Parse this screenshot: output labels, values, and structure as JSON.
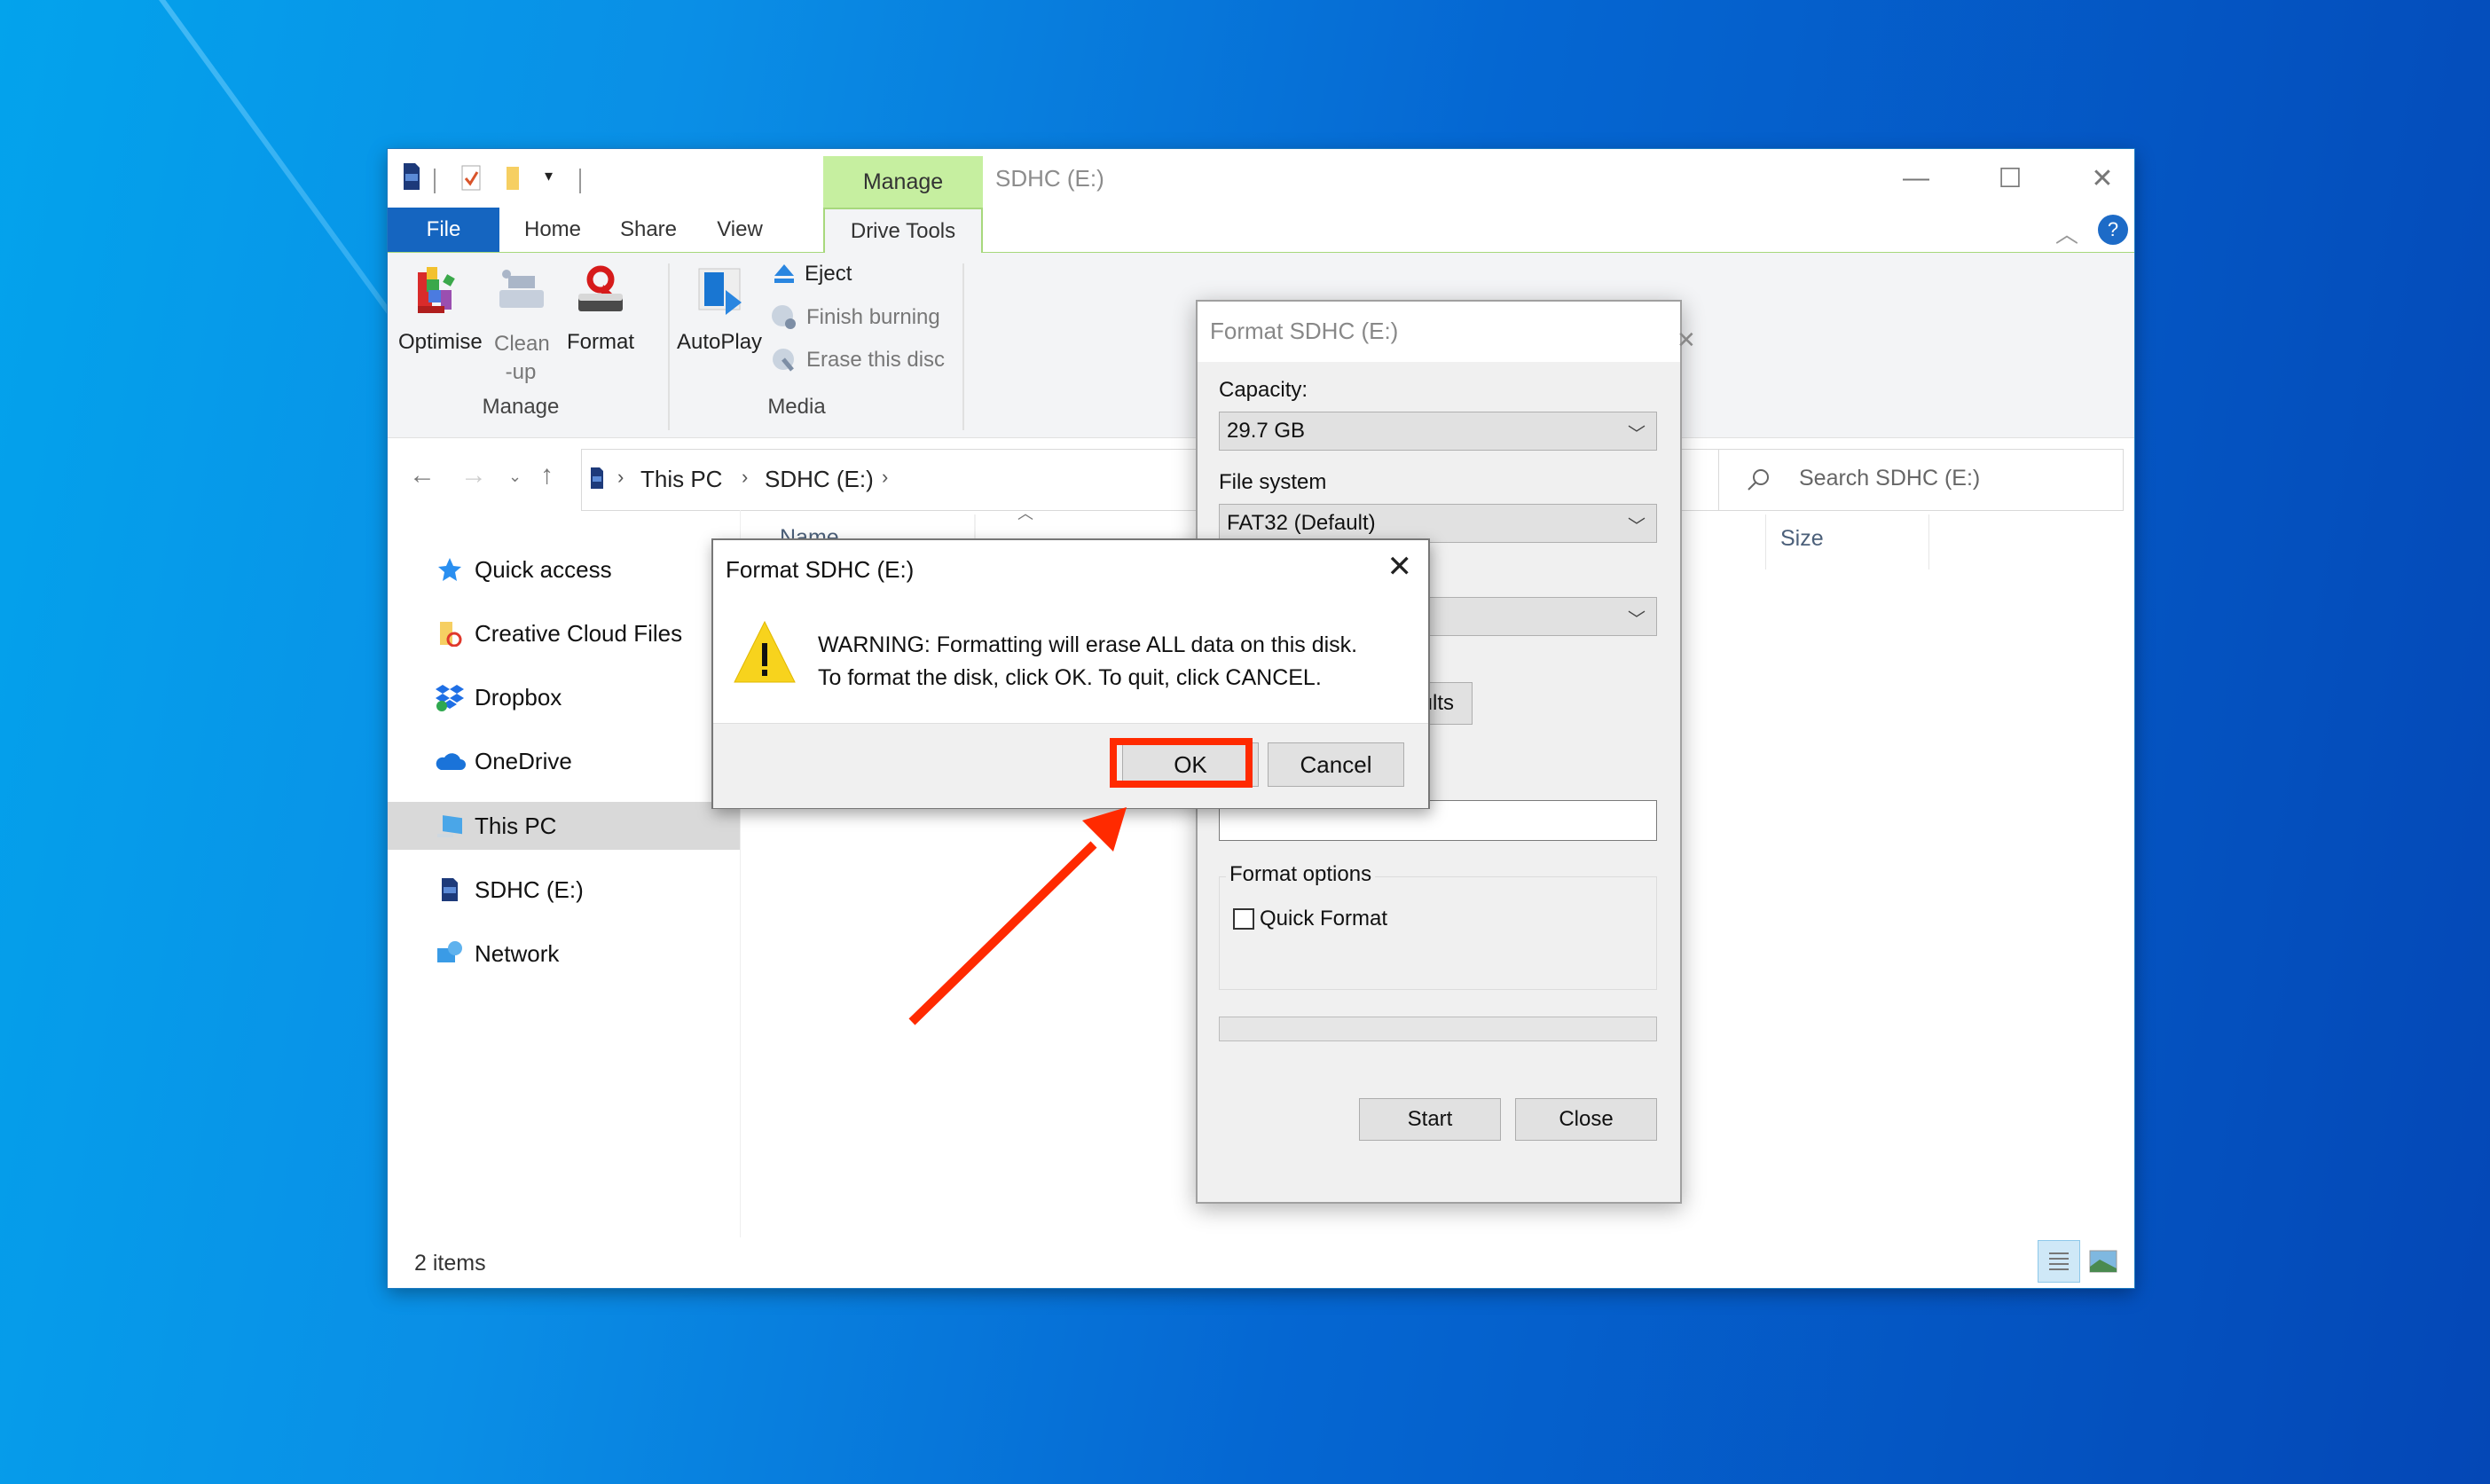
{
  "window": {
    "title": "SDHC (E:)",
    "context_tab": "Manage",
    "controls": {
      "minimize": "—",
      "maximize": "☐",
      "close": "✕"
    },
    "help": "?"
  },
  "ribbon_tabs": [
    {
      "label": "File"
    },
    {
      "label": "Home"
    },
    {
      "label": "Share"
    },
    {
      "label": "View"
    },
    {
      "label": "Drive Tools"
    }
  ],
  "ribbon": {
    "manage_group": {
      "label": "Manage",
      "buttons": [
        {
          "label": "Optimise",
          "enabled": true
        },
        {
          "label": "Clean\n-up",
          "line1": "Clean",
          "line2": "-up",
          "enabled": false
        },
        {
          "label": "Format",
          "enabled": true
        }
      ]
    },
    "media_group": {
      "label": "Media",
      "autoplay": "AutoPlay",
      "eject": "Eject",
      "finish_burning": "Finish burning",
      "erase_disc": "Erase this disc"
    }
  },
  "address": {
    "crumbs": [
      "This PC",
      "SDHC (E:)"
    ],
    "search_placeholder": "Search SDHC (E:)"
  },
  "nav_pane": {
    "items": [
      {
        "label": "Quick access",
        "icon": "star-icon"
      },
      {
        "label": "Creative Cloud Files",
        "icon": "creative-cloud-folder-icon"
      },
      {
        "label": "Dropbox",
        "icon": "dropbox-icon"
      },
      {
        "label": "OneDrive",
        "icon": "onedrive-cloud-icon"
      },
      {
        "label": "This PC",
        "icon": "computer-icon",
        "selected": true
      },
      {
        "label": "SDHC (E:)",
        "icon": "sd-card-icon"
      },
      {
        "label": "Network",
        "icon": "network-icon"
      }
    ]
  },
  "file_list": {
    "columns": [
      "Name",
      "Size"
    ]
  },
  "status_bar": {
    "items_count": "2 items"
  },
  "format_dialog": {
    "title": "Format SDHC (E:)",
    "capacity_label": "Capacity:",
    "capacity_value": "29.7 GB",
    "file_system_label": "File system",
    "file_system_value": "FAT32 (Default)",
    "restore_defaults_partial": "ults",
    "volume_label_value": "",
    "format_options_label": "Format options",
    "quick_format_label": "Quick Format",
    "quick_format_checked": false,
    "progress": 0,
    "start_label": "Start",
    "close_label": "Close"
  },
  "warning_dialog": {
    "title": "Format SDHC (E:)",
    "message_line1": "WARNING: Formatting will erase ALL data on this disk.",
    "message_line2": "To format the disk, click OK. To quit, click CANCEL.",
    "ok_label": "OK",
    "cancel_label": "Cancel"
  },
  "annotation": {
    "highlight_color": "#ff2a00",
    "target": "OK"
  }
}
